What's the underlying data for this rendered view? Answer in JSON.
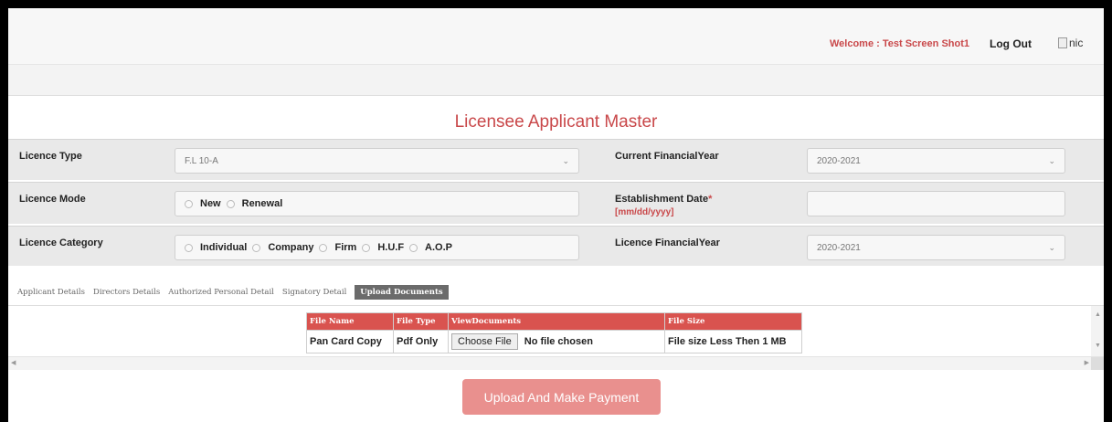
{
  "header": {
    "welcome": "Welcome : Test Screen Shot1",
    "logout": "Log Out",
    "logo_alt": "nic"
  },
  "title": "Licensee Applicant Master",
  "form": {
    "licence_type": {
      "label": "Licence Type",
      "value": "F.L 10-A"
    },
    "current_financial_year": {
      "label": "Current FinancialYear",
      "value": "2020-2021"
    },
    "licence_mode": {
      "label": "Licence Mode",
      "options": [
        "New",
        "Renewal"
      ]
    },
    "establishment_date": {
      "label": "Establishment Date",
      "required_mark": "*",
      "hint": "[mm/dd/yyyy]",
      "value": ""
    },
    "licence_category": {
      "label": "Licence Category",
      "options": [
        "Individual",
        "Company",
        "Firm",
        "H.U.F",
        "A.O.P"
      ]
    },
    "licence_financial_year": {
      "label": "Licence FinancialYear",
      "value": "2020-2021"
    }
  },
  "tabs": [
    "Applicant Details",
    "Directors Details",
    "Authorized Personal Detail",
    "Signatory Detail",
    "Upload Documents"
  ],
  "active_tab": "Upload Documents",
  "documents": {
    "headers": [
      "File Name",
      "File Type",
      "ViewDocuments",
      "File Size"
    ],
    "rows": [
      {
        "file_name": "Pan Card Copy",
        "file_type": "Pdf Only",
        "choose_label": "Choose File",
        "chosen": "No file chosen",
        "file_size": "File size Less Then 1 MB"
      }
    ]
  },
  "submit_label": "Upload And Make Payment",
  "colors": {
    "accent": "#c9484a",
    "table_header": "#d9534f",
    "button": "#e9908e"
  }
}
